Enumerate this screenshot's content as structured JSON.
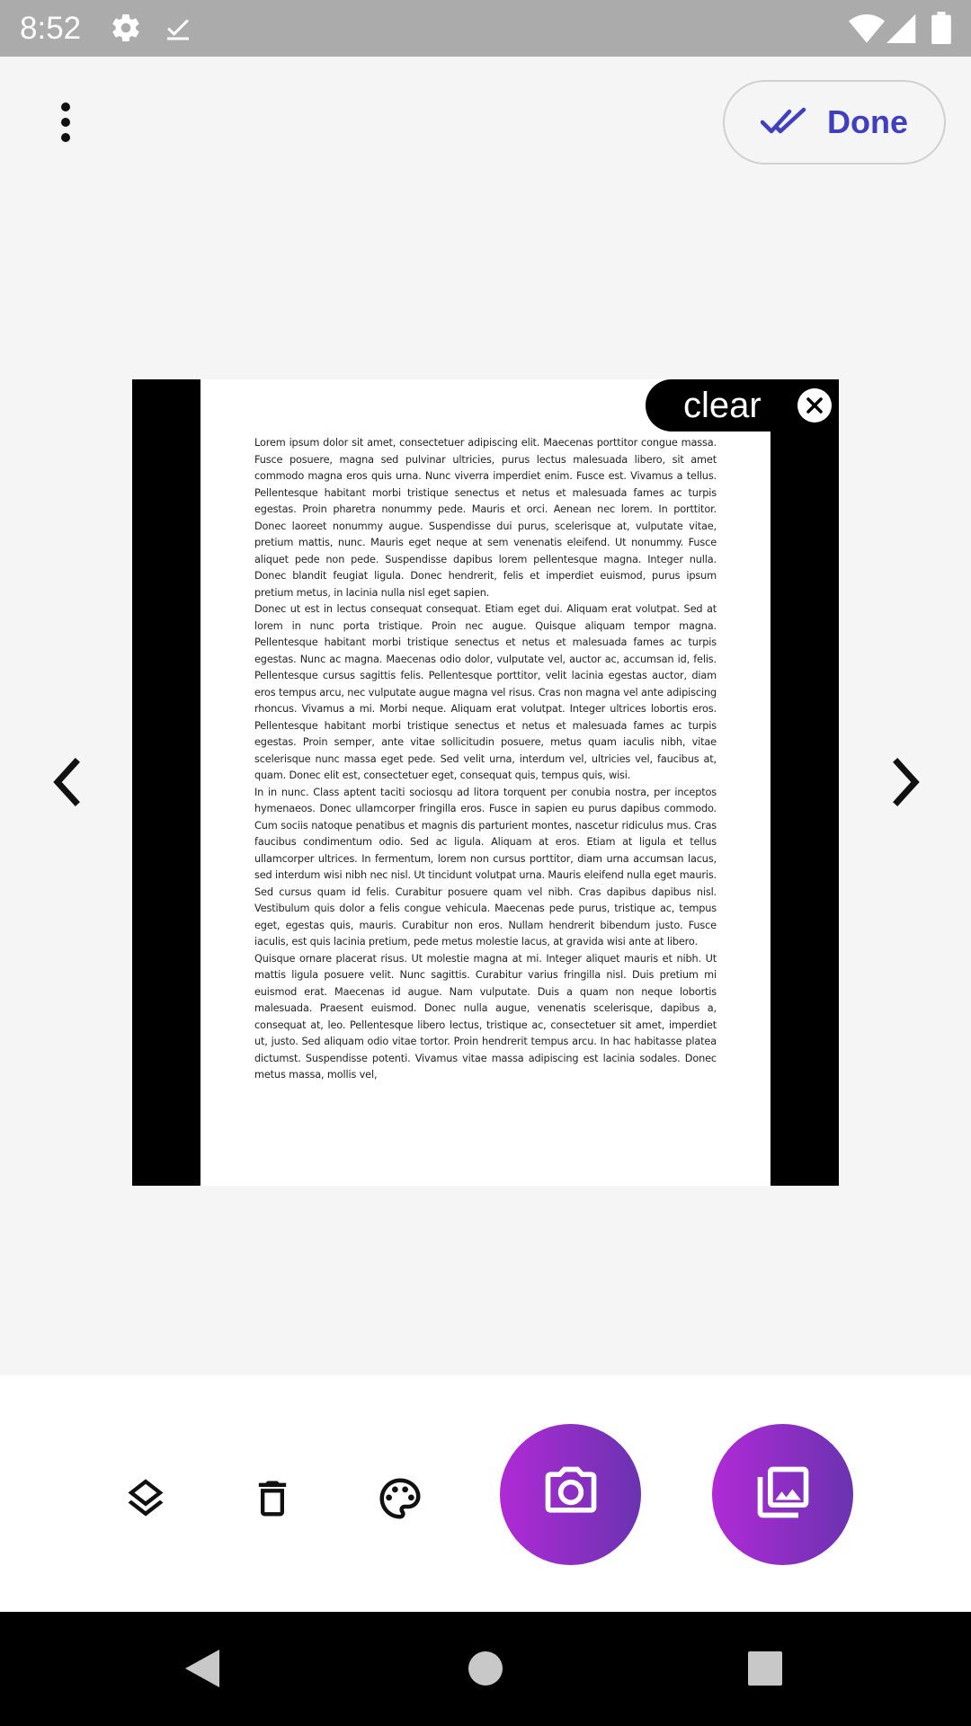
{
  "status_bar": {
    "time": "8:52",
    "left_icons": [
      "gear-icon",
      "check-download-icon"
    ],
    "right_icons": [
      "wifi-icon",
      "signal-icon",
      "battery-icon"
    ]
  },
  "header": {
    "menu_icon": "more-vert-icon",
    "done_label": "Done",
    "done_icon": "double-check-icon",
    "accent_color": "#3f3fc0"
  },
  "preview": {
    "clear_label": "clear",
    "clear_icon": "close-circle-icon",
    "prev_icon": "chevron-left-icon",
    "next_icon": "chevron-right-icon",
    "document_paragraphs": [
      "Lorem ipsum dolor sit amet, consectetuer adipiscing elit. Maecenas porttitor congue massa. Fusce posuere, magna sed pulvinar ultricies, purus lectus malesuada libero, sit amet commodo magna eros quis urna. Nunc viverra imperdiet enim. Fusce est. Vivamus a tellus. Pellentesque habitant morbi tristique senectus et netus et malesuada fames ac turpis egestas. Proin pharetra nonummy pede. Mauris et orci. Aenean nec lorem. In porttitor. Donec laoreet nonummy augue. Suspendisse dui purus, scelerisque at, vulputate vitae, pretium mattis, nunc. Mauris eget neque at sem venenatis eleifend. Ut nonummy. Fusce aliquet pede non pede. Suspendisse dapibus lorem pellentesque magna. Integer nulla. Donec blandit feugiat ligula. Donec hendrerit, felis et imperdiet euismod, purus ipsum pretium metus, in lacinia nulla nisl eget sapien.",
      "Donec ut est in lectus consequat consequat. Etiam eget dui. Aliquam erat volutpat. Sed at lorem in nunc porta tristique. Proin nec augue. Quisque aliquam tempor magna. Pellentesque habitant morbi tristique senectus et netus et malesuada fames ac turpis egestas. Nunc ac magna. Maecenas odio dolor, vulputate vel, auctor ac, accumsan id, felis. Pellentesque cursus sagittis felis. Pellentesque porttitor, velit lacinia egestas auctor, diam eros tempus arcu, nec vulputate augue magna vel risus. Cras non magna vel ante adipiscing rhoncus. Vivamus a mi. Morbi neque. Aliquam erat volutpat. Integer ultrices lobortis eros. Pellentesque habitant morbi tristique senectus et netus et malesuada fames ac turpis egestas. Proin semper, ante vitae sollicitudin posuere, metus quam iaculis nibh, vitae scelerisque nunc massa eget pede. Sed velit urna, interdum vel, ultricies vel, faucibus at, quam. Donec elit est, consectetuer eget, consequat quis, tempus quis, wisi.",
      "In in nunc. Class aptent taciti sociosqu ad litora torquent per conubia nostra, per inceptos hymenaeos. Donec ullamcorper fringilla eros. Fusce in sapien eu purus dapibus commodo. Cum sociis natoque penatibus et magnis dis parturient montes, nascetur ridiculus mus. Cras faucibus condimentum odio. Sed ac ligula. Aliquam at eros. Etiam at ligula et tellus ullamcorper ultrices. In fermentum, lorem non cursus porttitor, diam urna accumsan lacus, sed interdum wisi nibh nec nisl. Ut tincidunt volutpat urna. Mauris eleifend nulla eget mauris. Sed cursus quam id felis. Curabitur posuere quam vel nibh. Cras dapibus dapibus nisl. Vestibulum quis dolor a felis congue vehicula. Maecenas pede purus, tristique ac, tempus eget, egestas quis, mauris. Curabitur non eros. Nullam hendrerit bibendum justo. Fusce iaculis, est quis lacinia pretium, pede metus molestie lacus, at gravida wisi ante at libero.",
      "Quisque ornare placerat risus. Ut molestie magna at mi. Integer aliquet mauris et nibh. Ut mattis ligula posuere velit. Nunc sagittis. Curabitur varius fringilla nisl. Duis pretium mi euismod erat. Maecenas id augue. Nam vulputate. Duis a quam non neque lobortis malesuada. Praesent euismod. Donec nulla augue, venenatis scelerisque, dapibus a, consequat at, leo. Pellentesque libero lectus, tristique ac, consectetuer sit amet, imperdiet ut, justo. Sed aliquam odio vitae tortor. Proin hendrerit tempus arcu. In hac habitasse platea dictumst. Suspendisse potenti. Vivamus vitae massa adipiscing est lacinia sodales. Donec metus massa, mollis vel,"
    ]
  },
  "toolbar": {
    "tools": [
      "layers-icon",
      "delete-icon",
      "palette-icon"
    ],
    "camera_icon": "camera-icon",
    "gallery_icon": "gallery-icon",
    "fab_colors": [
      "#b02ad6",
      "#6a33b0"
    ]
  },
  "system_nav": {
    "buttons": [
      "back-icon",
      "home-icon",
      "recents-icon"
    ]
  }
}
